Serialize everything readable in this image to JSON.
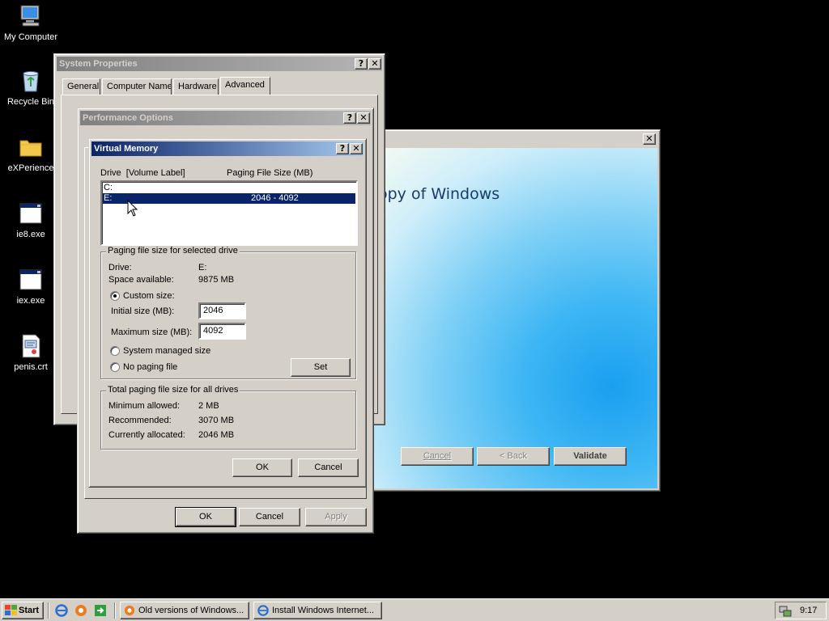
{
  "desktop": {
    "icons": [
      {
        "label": "My Computer",
        "icon": "my-computer-icon"
      },
      {
        "label": "Recycle Bin",
        "icon": "recycle-bin-icon"
      },
      {
        "label": "eXPerience",
        "icon": "folder-icon"
      },
      {
        "label": "ie8.exe",
        "icon": "exe-icon"
      },
      {
        "label": "iex.exe",
        "icon": "exe-icon"
      },
      {
        "label": "penis.crt",
        "icon": "certificate-icon"
      }
    ]
  },
  "system_properties": {
    "title": "System Properties",
    "help": "?",
    "close": "✕",
    "tabs": [
      {
        "label": "General"
      },
      {
        "label": "Computer Name"
      },
      {
        "label": "Hardware"
      },
      {
        "label": "Advanced",
        "selected": true
      }
    ]
  },
  "performance_options": {
    "title": "Performance Options",
    "help": "?",
    "close": "✕",
    "buttons": {
      "ok": "OK",
      "cancel": "Cancel",
      "apply": "Apply"
    }
  },
  "validation_window": {
    "close": "✕",
    "heading": "opy of Windows",
    "buttons": {
      "cancel": "Cancel",
      "back": "< Back",
      "validate": "Validate"
    }
  },
  "virtual_memory": {
    "title": "Virtual Memory",
    "help": "?",
    "close": "✕",
    "drive_header": "Drive  [Volume Label]",
    "size_header": "Paging File Size (MB)",
    "drives": [
      {
        "drive": "C:",
        "size": ""
      },
      {
        "drive": "E:",
        "size": "2046 - 4092",
        "selected": true
      }
    ],
    "selected_group": {
      "label": "Paging file size for selected drive",
      "drive_label": "Drive:",
      "drive_value": "E:",
      "space_label": "Space available:",
      "space_value": "9875 MB",
      "custom_size": "Custom size:",
      "initial_label": "Initial size (MB):",
      "initial_value": "2046",
      "maximum_label": "Maximum size (MB):",
      "maximum_value": "4092",
      "system_managed": "System managed size",
      "no_paging": "No paging file",
      "set_button": "Set"
    },
    "total_group": {
      "label": "Total paging file size for all drives",
      "min_label": "Minimum allowed:",
      "min_value": "2 MB",
      "rec_label": "Recommended:",
      "rec_value": "3070 MB",
      "cur_label": "Currently allocated:",
      "cur_value": "2046 MB"
    },
    "buttons": {
      "ok": "OK",
      "cancel": "Cancel"
    }
  },
  "taskbar": {
    "start": "Start",
    "tasks": [
      {
        "label": "Old versions of Windows..."
      },
      {
        "label": "Install Windows Internet..."
      }
    ],
    "clock": "9:17"
  },
  "colors": {
    "active_title": "#0a246a",
    "inactive_title": "#808080",
    "selection": "#0a246a",
    "face": "#d4d0c8",
    "desktop": "#000000"
  }
}
